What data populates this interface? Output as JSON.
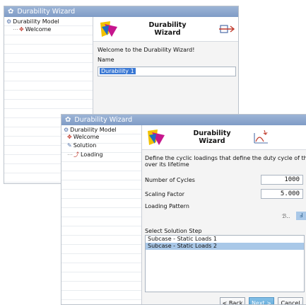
{
  "window1": {
    "title": "Durability Wizard",
    "tree": {
      "root": "Durability Model",
      "welcome": "Welcome"
    },
    "header_title": "Durability Wizard",
    "welcome_text": "Welcome to the Durability Wizard!",
    "name_label": "Name",
    "name_value": "Durability 1"
  },
  "window2": {
    "title": "Durability Wizard",
    "tree": {
      "root": "Durability Model",
      "welcome": "Welcome",
      "solution": "Solution",
      "loading": "Loading"
    },
    "header_title": "Durability Wizard",
    "description": "Define the cyclic loadings that define the duty cycle of the pa",
    "description_line2": "over its lifetime",
    "cycles_label": "Number of Cycles",
    "cycles_value": "1000",
    "scaling_label": "Scaling Factor",
    "scaling_value": "5.000",
    "pattern_label": "Loading Pattern",
    "solution_step_label": "Select Solution Step",
    "solution_steps": [
      "Subcase - Static Loads 1",
      "Subcase - Static Loads 2"
    ],
    "selected_step_index": 1,
    "buttons": {
      "back": "< Back",
      "next": "Next >",
      "cancel": "Cancel"
    }
  },
  "colors": {
    "titlebar": "#8aa6cf",
    "selection": "#3a78d4",
    "list_selection": "#a9c8e8",
    "next_button": "#5aa4d6"
  }
}
